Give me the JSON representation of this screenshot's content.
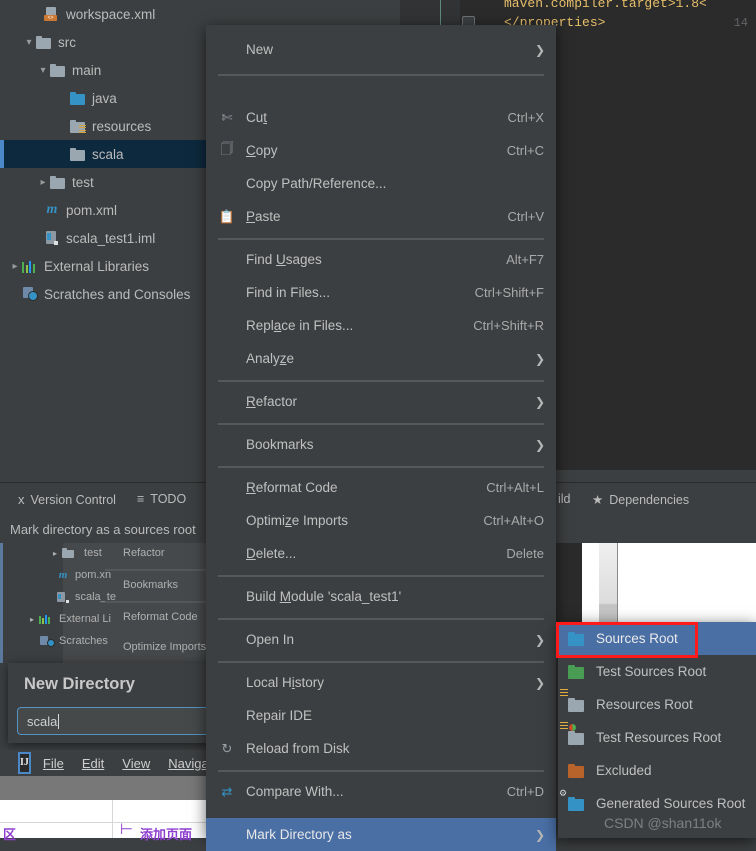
{
  "editor": {
    "lines": [
      {
        "number": "",
        "text": "maven.compiler.target>1.8<"
      },
      {
        "number": "14",
        "text": "</properties>"
      }
    ]
  },
  "project_tree": {
    "items": [
      {
        "label": "workspace.xml",
        "icon": "xml-file-icon",
        "indent": 3,
        "arrow": "",
        "selected": false
      },
      {
        "label": "src",
        "icon": "folder-gray-icon",
        "indent": 1,
        "arrow": "v",
        "selected": false
      },
      {
        "label": "main",
        "icon": "folder-gray-icon",
        "indent": 2,
        "arrow": "v",
        "selected": false
      },
      {
        "label": "java",
        "icon": "folder-blue-icon",
        "indent": 3,
        "arrow": "",
        "selected": false
      },
      {
        "label": "resources",
        "icon": "folder-resources-icon",
        "indent": 3,
        "arrow": "",
        "selected": false
      },
      {
        "label": "scala",
        "icon": "folder-gray-icon",
        "indent": 3,
        "arrow": "",
        "selected": true
      },
      {
        "label": "test",
        "icon": "folder-gray-icon",
        "indent": 2,
        "arrow": ">",
        "selected": false
      },
      {
        "label": "pom.xml",
        "icon": "maven-icon",
        "indent": 2,
        "arrow": "",
        "selected": false
      },
      {
        "label": "scala_test1.iml",
        "icon": "iml-file-icon",
        "indent": 2,
        "arrow": "",
        "selected": false
      },
      {
        "label": "External Libraries",
        "icon": "library-icon",
        "indent": 0,
        "arrow": ">",
        "selected": false
      },
      {
        "label": "Scratches and Consoles",
        "icon": "scratches-icon",
        "indent": 1,
        "arrow": "",
        "selected": false
      }
    ]
  },
  "tool_windows": {
    "version_control": "Version Control",
    "todo": "TODO",
    "build": "ild",
    "dependencies": "Dependencies"
  },
  "status_bar": {
    "message": "Mark directory as a sources root"
  },
  "context_menu": {
    "items": [
      {
        "label": "New",
        "mnemonic": "",
        "shortcut": "",
        "submenu": true,
        "icon": "",
        "separator_after": true
      },
      {
        "label": "Cut",
        "mnemonic": "t",
        "shortcut": "Ctrl+X",
        "submenu": false,
        "icon": "scissors-icon",
        "separator_after": false
      },
      {
        "label": "Copy",
        "mnemonic": "C",
        "shortcut": "Ctrl+C",
        "submenu": false,
        "icon": "copy-icon",
        "separator_after": false
      },
      {
        "label": "Copy Path/Reference...",
        "mnemonic": "",
        "shortcut": "",
        "submenu": false,
        "icon": "",
        "separator_after": false
      },
      {
        "label": "Paste",
        "mnemonic": "P",
        "shortcut": "Ctrl+V",
        "submenu": false,
        "icon": "paste-icon",
        "separator_after": true
      },
      {
        "label": "Find Usages",
        "mnemonic": "U",
        "shortcut": "Alt+F7",
        "submenu": false,
        "icon": "",
        "separator_after": false
      },
      {
        "label": "Find in Files...",
        "mnemonic": "",
        "shortcut": "Ctrl+Shift+F",
        "submenu": false,
        "icon": "",
        "separator_after": false
      },
      {
        "label": "Replace in Files...",
        "mnemonic": "a",
        "shortcut": "Ctrl+Shift+R",
        "submenu": false,
        "icon": "",
        "separator_after": false
      },
      {
        "label": "Analyze",
        "mnemonic": "z",
        "shortcut": "",
        "submenu": true,
        "icon": "",
        "separator_after": true
      },
      {
        "label": "Refactor",
        "mnemonic": "R",
        "shortcut": "",
        "submenu": true,
        "icon": "",
        "separator_after": true
      },
      {
        "label": "Bookmarks",
        "mnemonic": "",
        "shortcut": "",
        "submenu": true,
        "icon": "",
        "separator_after": true
      },
      {
        "label": "Reformat Code",
        "mnemonic": "R",
        "shortcut": "Ctrl+Alt+L",
        "submenu": false,
        "icon": "",
        "separator_after": false
      },
      {
        "label": "Optimize Imports",
        "mnemonic": "z",
        "shortcut": "Ctrl+Alt+O",
        "submenu": false,
        "icon": "",
        "separator_after": false
      },
      {
        "label": "Delete...",
        "mnemonic": "D",
        "shortcut": "Delete",
        "submenu": false,
        "icon": "",
        "separator_after": true
      },
      {
        "label": "Build Module 'scala_test1'",
        "mnemonic": "M",
        "shortcut": "",
        "submenu": false,
        "icon": "",
        "separator_after": true
      },
      {
        "label": "Open In",
        "mnemonic": "",
        "shortcut": "",
        "submenu": true,
        "icon": "",
        "separator_after": true
      },
      {
        "label": "Local History",
        "mnemonic": "i",
        "shortcut": "",
        "submenu": true,
        "icon": "",
        "separator_after": false
      },
      {
        "label": "Repair IDE",
        "mnemonic": "",
        "shortcut": "",
        "submenu": false,
        "icon": "",
        "separator_after": false
      },
      {
        "label": "Reload from Disk",
        "mnemonic": "",
        "shortcut": "",
        "submenu": false,
        "icon": "reload-icon",
        "separator_after": true
      },
      {
        "label": "Compare With...",
        "mnemonic": "",
        "shortcut": "Ctrl+D",
        "submenu": false,
        "icon": "compare-icon",
        "separator_after": false
      },
      {
        "label": "Mark Directory as",
        "mnemonic": "",
        "shortcut": "",
        "submenu": true,
        "icon": "",
        "separator_after": true,
        "highlighted": true
      }
    ]
  },
  "submenu": {
    "items": [
      {
        "label": "Sources Root",
        "icon": "folder-blue-icon",
        "highlighted": true,
        "annotated": true
      },
      {
        "label": "Test Sources Root",
        "icon": "folder-green-icon",
        "highlighted": false,
        "annotated": false
      },
      {
        "label": "Resources Root",
        "icon": "folder-resources-icon",
        "highlighted": false,
        "annotated": false
      },
      {
        "label": "Test Resources Root",
        "icon": "folder-test-resources-icon",
        "highlighted": false,
        "annotated": false
      },
      {
        "label": "Excluded",
        "icon": "folder-orange-icon",
        "highlighted": false,
        "annotated": false
      },
      {
        "label": "Generated Sources Root",
        "icon": "folder-generated-icon",
        "highlighted": false,
        "annotated": false
      }
    ]
  },
  "ghost_window": {
    "tree": [
      {
        "label": "test",
        "arrow": ">"
      },
      {
        "label": "pom.xn",
        "arrow": ""
      },
      {
        "label": "scala_te",
        "arrow": ""
      },
      {
        "label": "External Li",
        "arrow": ">"
      },
      {
        "label": "Scratches",
        "arrow": ""
      }
    ],
    "menu": [
      "Refactor",
      "Bookmarks",
      "Reformat Code",
      "Optimize Imports"
    ]
  },
  "new_directory_dialog": {
    "title": "New Directory",
    "input_value": "scala"
  },
  "ghost_menubar": {
    "logo": "IJ",
    "items": [
      "File",
      "Edit",
      "View",
      "Naviga"
    ]
  },
  "bottom_strip": {
    "left_text": "区",
    "right_text": "添加页面"
  },
  "watermark": "CSDN @shan11ok",
  "colors": {
    "background": "#3c3f41",
    "editor_background": "#2b2b2b",
    "menu_highlight": "#4a6fa5",
    "tree_selection": "#0d293e",
    "selection_accent": "#4a88c7",
    "annotation_red": "#ff1a1a",
    "xml_tag": "#e8bf6a"
  }
}
